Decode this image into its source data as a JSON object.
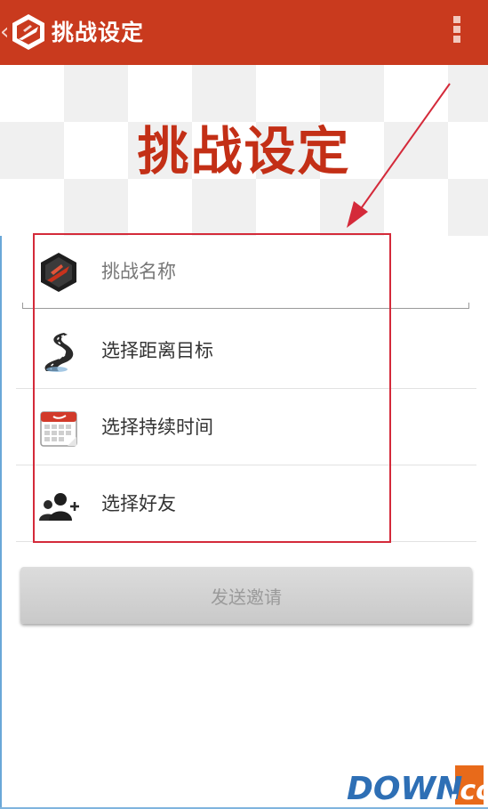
{
  "app_bar": {
    "title": "挑战设定",
    "back_glyph": "‹",
    "logo_icon": "app-logo-icon",
    "menu_icon": "overflow-menu-icon",
    "color": "#c93a1e"
  },
  "hero": {
    "title": "挑战设定",
    "title_color": "#c32f16"
  },
  "form": {
    "name_placeholder": "挑战名称",
    "items": [
      {
        "label": "选择距离目标",
        "icon": "road-icon"
      },
      {
        "label": "选择持续时间",
        "icon": "calendar-icon"
      },
      {
        "label": "选择好友",
        "icon": "add-friends-icon"
      }
    ]
  },
  "actions": {
    "send_label": "发送邀请"
  },
  "annotation": {
    "box_color": "#d42a3a"
  },
  "watermark": {
    "text_main": "DOWN",
    "text_suffix": ".cc"
  }
}
